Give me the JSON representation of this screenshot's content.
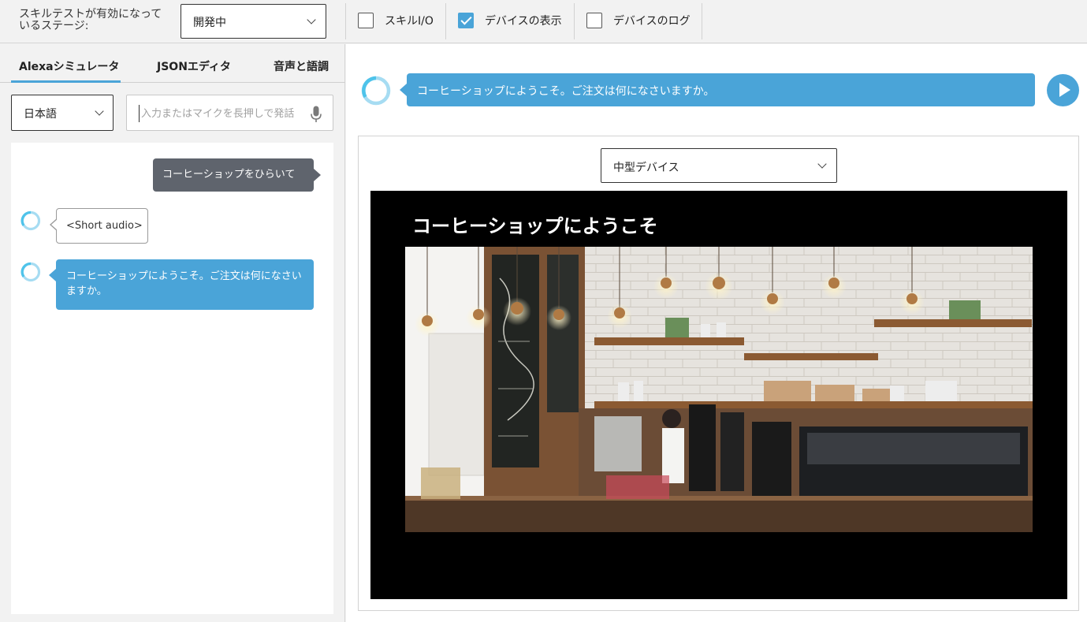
{
  "toolbar": {
    "stage_label": "スキルテストが有効になっているステージ:",
    "stage_value": "開発中",
    "checks": [
      {
        "label": "スキルI/O",
        "checked": false
      },
      {
        "label": "デバイスの表示",
        "checked": true
      },
      {
        "label": "デバイスのログ",
        "checked": false
      }
    ]
  },
  "tabs": [
    {
      "label": "Alexaシミュレータ",
      "active": true
    },
    {
      "label": "JSONエディタ",
      "active": false
    },
    {
      "label": "音声と語調",
      "active": false
    }
  ],
  "simulator": {
    "language": "日本語",
    "input_value": "",
    "input_placeholder": "入力またはマイクを長押しで発話"
  },
  "chat": {
    "user_message": "コーヒーショップをひらいて",
    "audio_message": "<Short audio>",
    "alexa_message": "コーヒーショップにようこそ。ご注文は何になさいますか。"
  },
  "device": {
    "response": "コーヒーショップにようこそ。ご注文は何になさいますか。",
    "size_option": "中型デバイス",
    "screen_title": "コーヒーショップにようこそ"
  },
  "colors": {
    "accent": "#4aa4d8",
    "user_bubble": "#5f646d",
    "screen_bg": "#000000"
  },
  "icons": {
    "mic": "microphone-icon",
    "play": "play-icon",
    "alexa": "alexa-ring-icon"
  }
}
